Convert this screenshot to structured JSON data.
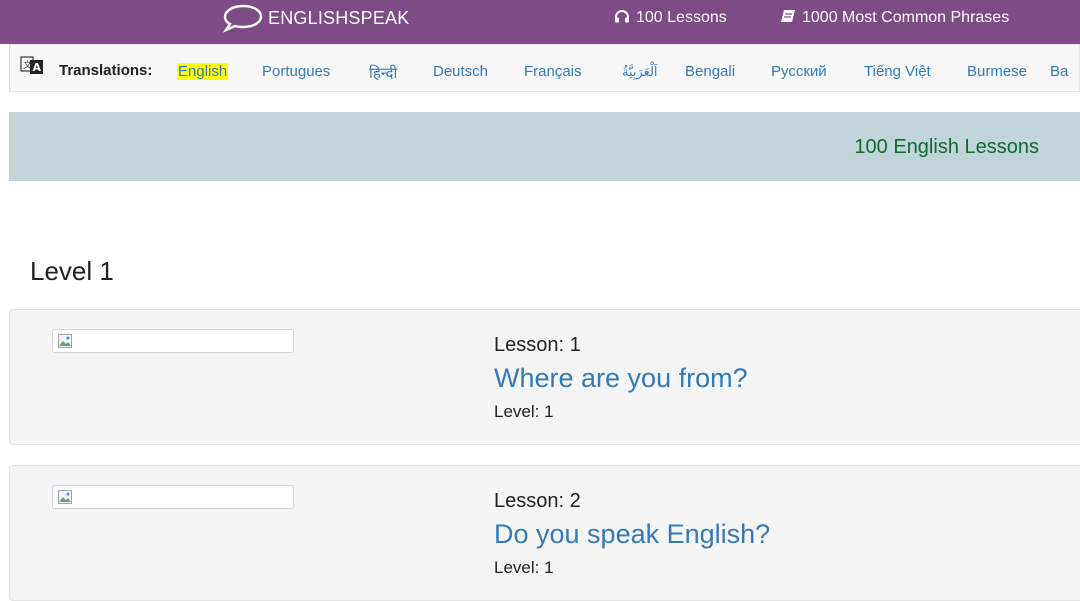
{
  "topnav": {
    "brand": "ENGLISHSPEAK",
    "lessons_link": "100 Lessons",
    "phrases_link": "1000 Most Common Phrases",
    "background_color": "#7e4b86",
    "brand_icon": "speech-bubble-icon",
    "lessons_icon": "headphones-icon",
    "phrases_icon": "book-icon"
  },
  "translations": {
    "label": "Translations:",
    "icon": "translate-icon",
    "languages": [
      {
        "label": "English",
        "active": true
      },
      {
        "label": "Portugues"
      },
      {
        "label": "हिन्दी"
      },
      {
        "label": "Deutsch"
      },
      {
        "label": "Français"
      },
      {
        "label": "اَلْعَرَبِيَّةُ"
      },
      {
        "label": "Bengali"
      },
      {
        "label": "Русский"
      },
      {
        "label": "Tiếng Việt"
      },
      {
        "label": "Burmese"
      },
      {
        "label": "Ba"
      }
    ]
  },
  "banner": {
    "text": "100 English Lessons",
    "background_color": "#c1d4da",
    "text_color": "#116b2e"
  },
  "level": {
    "heading": "Level 1"
  },
  "lessons": [
    {
      "number_label": "Lesson: 1",
      "title": "Where are you from?",
      "level_label": "Level: 1"
    },
    {
      "number_label": "Lesson: 2",
      "title": "Do you speak English?",
      "level_label": "Level: 1"
    }
  ]
}
